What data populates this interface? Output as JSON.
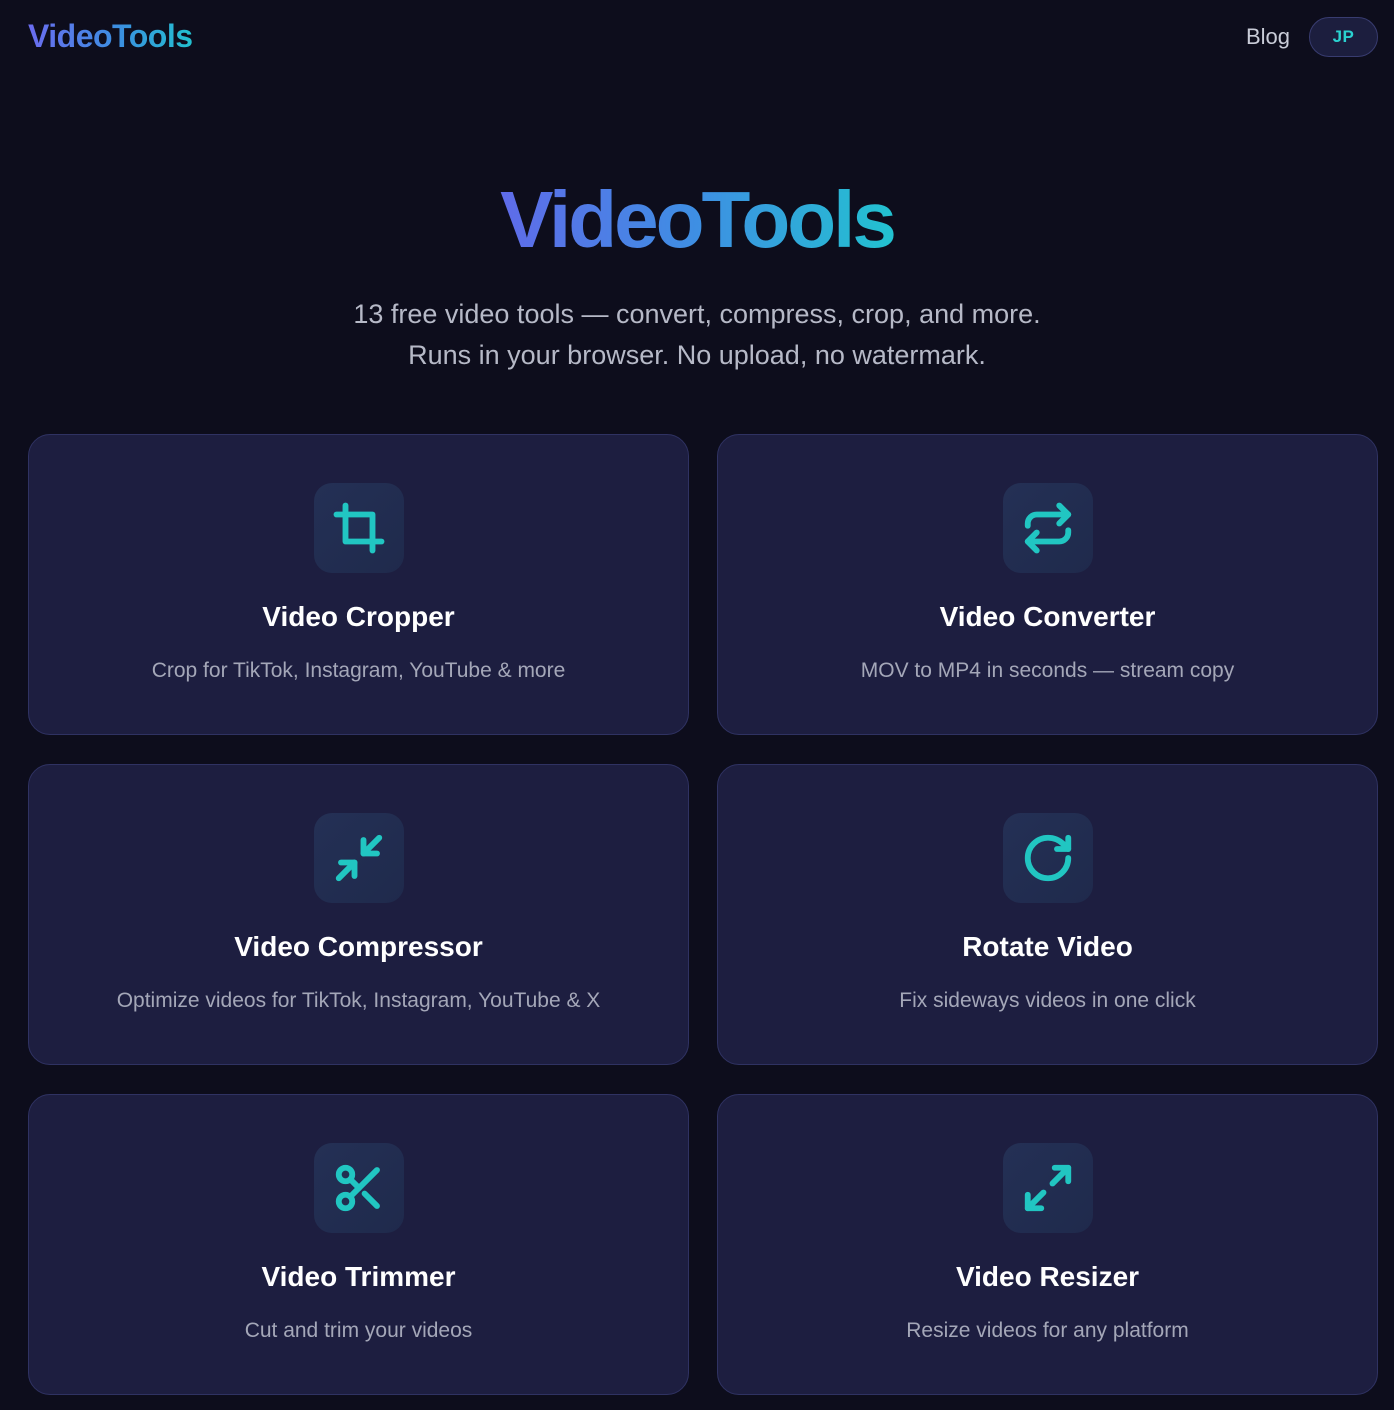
{
  "header": {
    "logo": "VideoTools",
    "nav_blog": "Blog",
    "lang_button": "JP"
  },
  "hero": {
    "title": "VideoTools",
    "subtitle_line1": "13 free video tools — convert, compress, crop, and more.",
    "subtitle_line2": "Runs in your browser. No upload, no watermark."
  },
  "colors": {
    "background": "#0d0d1c",
    "card": "#1d1e40",
    "accent": "#21c6c2",
    "gradient_start": "#5f6be9",
    "gradient_end": "#22c2d0"
  },
  "tools": [
    {
      "title": "Video Cropper",
      "desc": "Crop for TikTok, Instagram, YouTube & more",
      "icon": "crop-icon"
    },
    {
      "title": "Video Converter",
      "desc": "MOV to MP4 in seconds — stream copy",
      "icon": "convert-arrows-icon"
    },
    {
      "title": "Video Compressor",
      "desc": "Optimize videos for TikTok, Instagram, YouTube & X",
      "icon": "compress-arrows-icon"
    },
    {
      "title": "Rotate Video",
      "desc": "Fix sideways videos in one click",
      "icon": "rotate-icon"
    },
    {
      "title": "Video Trimmer",
      "desc": "Cut and trim your videos",
      "icon": "scissors-icon"
    },
    {
      "title": "Video Resizer",
      "desc": "Resize videos for any platform",
      "icon": "expand-arrows-icon"
    }
  ]
}
